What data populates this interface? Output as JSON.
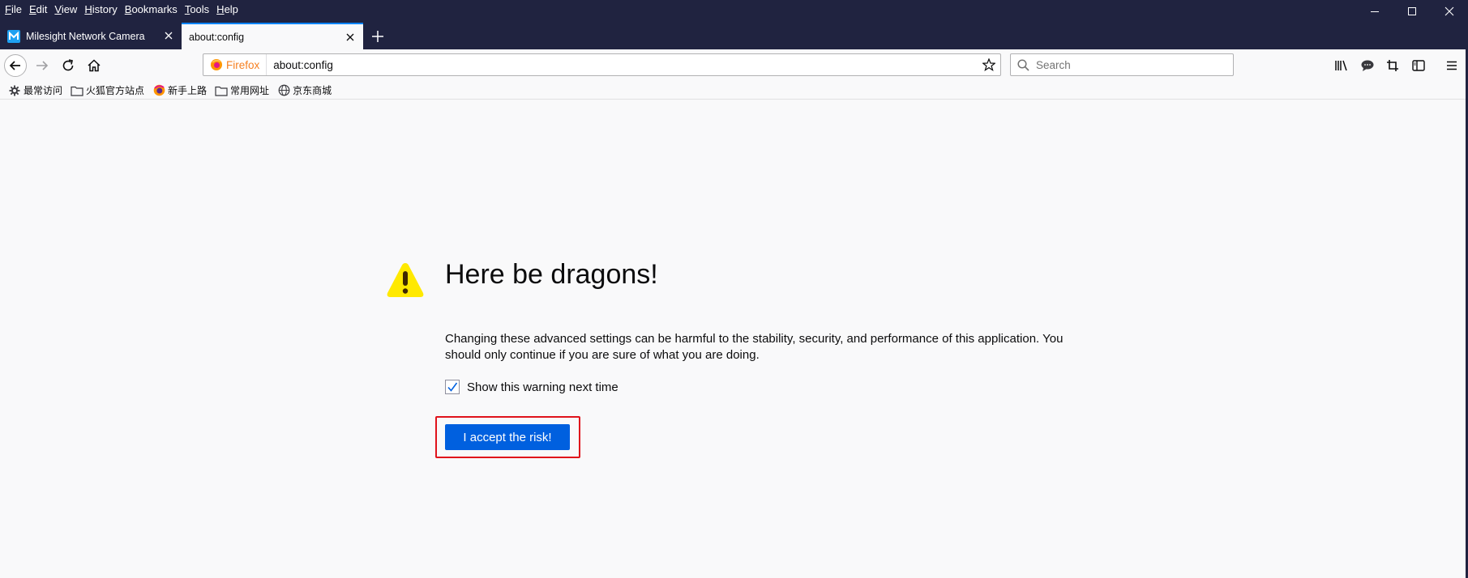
{
  "menubar": {
    "items": [
      {
        "label": "File"
      },
      {
        "label": "Edit"
      },
      {
        "label": "View"
      },
      {
        "label": "History"
      },
      {
        "label": "Bookmarks"
      },
      {
        "label": "Tools"
      },
      {
        "label": "Help"
      }
    ]
  },
  "tabs": [
    {
      "title": "Milesight Network Camera",
      "active": false,
      "favicon": "milesight-m-icon"
    },
    {
      "title": "about:config",
      "active": true,
      "favicon": null
    }
  ],
  "urlbar": {
    "identity_label": "Firefox",
    "url": "about:config"
  },
  "search": {
    "placeholder": "Search"
  },
  "bookmarks": [
    {
      "label": "最常访问",
      "icon": "gear-icon"
    },
    {
      "label": "火狐官方站点",
      "icon": "folder-icon"
    },
    {
      "label": "新手上路",
      "icon": "firefox-icon"
    },
    {
      "label": "常用网址",
      "icon": "folder-icon"
    },
    {
      "label": "京东商城",
      "icon": "globe-icon"
    }
  ],
  "page": {
    "heading": "Here be dragons!",
    "message": "Changing these advanced settings can be harmful to the stability, security, and performance of this application. You should only continue if you are sure of what you are doing.",
    "checkbox_label": "Show this warning next time",
    "checkbox_checked": true,
    "accept_button": "I accept the risk!"
  },
  "colors": {
    "titlebar": "#202340",
    "accent": "#0a84ff",
    "button": "#0060df",
    "highlight": "#e0121b",
    "warning": "#ffe900"
  }
}
